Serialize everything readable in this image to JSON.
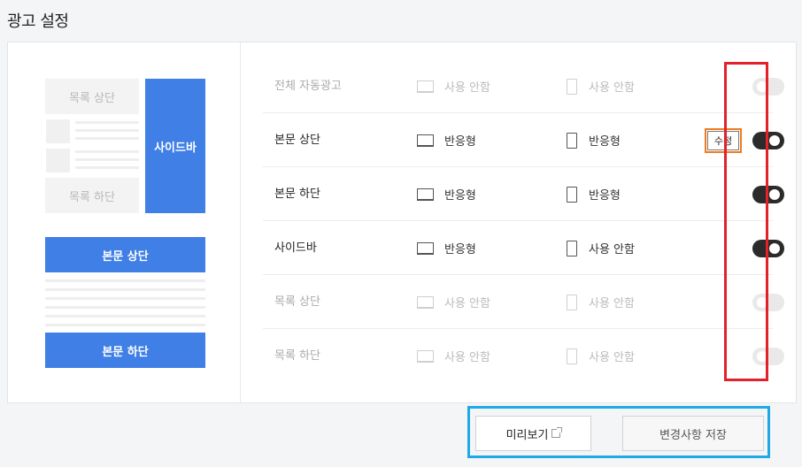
{
  "page_title": "광고 설정",
  "preview": {
    "list_top": "목록 상단",
    "sidebar": "사이드바",
    "list_bottom": "목록 하단",
    "body_top": "본문 상단",
    "body_bottom": "본문 하단"
  },
  "rows": [
    {
      "name": "전체 자동광고",
      "desktop": "사용 안함",
      "mobile": "사용 안함",
      "enabled": false
    },
    {
      "name": "본문 상단",
      "desktop": "반응형",
      "mobile": "반응형",
      "enabled": true,
      "edit_label": "수정"
    },
    {
      "name": "본문 하단",
      "desktop": "반응형",
      "mobile": "반응형",
      "enabled": true
    },
    {
      "name": "사이드바",
      "desktop": "반응형",
      "mobile": "사용 안함",
      "enabled": true
    },
    {
      "name": "목록 상단",
      "desktop": "사용 안함",
      "mobile": "사용 안함",
      "enabled": false
    },
    {
      "name": "목록 하단",
      "desktop": "사용 안함",
      "mobile": "사용 안함",
      "enabled": false
    }
  ],
  "footer": {
    "preview_label": "미리보기",
    "save_label": "변경사항 저장"
  },
  "colors": {
    "accent_blue": "#3f7fe6",
    "toggle_on": "#2b2b2b",
    "toggle_off": "#e9e9e9",
    "highlight_red": "#e3212b",
    "highlight_orange": "#ee7b21",
    "highlight_cyan": "#1ea9e6"
  }
}
